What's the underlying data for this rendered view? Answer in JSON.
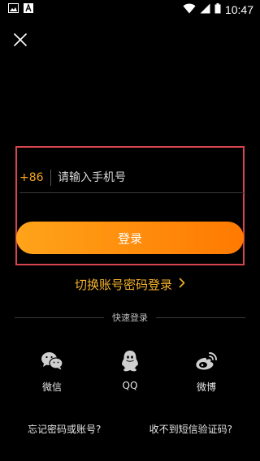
{
  "status_bar": {
    "time": "10:47",
    "left_icons": [
      "image-icon",
      "text-a-icon"
    ],
    "right_icons": [
      "wifi-icon",
      "signal-icon",
      "battery-icon"
    ]
  },
  "login": {
    "country_code": "+86",
    "phone_placeholder": "请输入手机号",
    "phone_value": "",
    "login_button": "登录",
    "switch_link": "切换账号密码登录"
  },
  "quick_login": {
    "label": "快速登录",
    "options": [
      {
        "label": "微信",
        "icon": "wechat-icon"
      },
      {
        "label": "QQ",
        "icon": "qq-icon"
      },
      {
        "label": "微博",
        "icon": "weibo-icon"
      }
    ]
  },
  "footer": {
    "forgot_link": "忘记密码或账号?",
    "no_sms_link": "收不到短信验证码?"
  },
  "colors": {
    "accent": "#f5a623",
    "button_start": "#ffa41a",
    "button_end": "#ff7a00",
    "highlight_border": "#d6454f",
    "background": "#000000"
  }
}
